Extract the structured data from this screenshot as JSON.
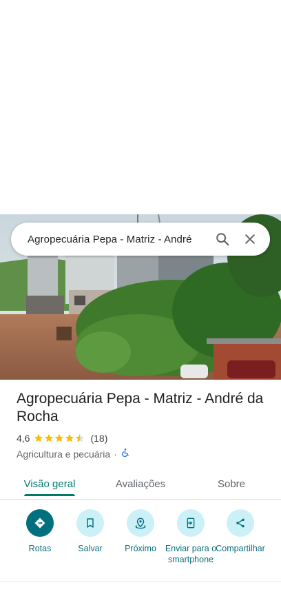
{
  "search": {
    "query": "Agropecuária Pepa - Matriz - André",
    "search_icon": "search-icon",
    "close_icon": "close-icon"
  },
  "place": {
    "name": "Agropecuária Pepa - Matriz - André da Rocha",
    "rating": "4,6",
    "stars": 4.6,
    "reviews": "(18)",
    "category": "Agricultura e pecuária",
    "separator": "·",
    "accessibility_icon": "wheelchair-icon"
  },
  "tabs": [
    {
      "label": "Visão geral"
    },
    {
      "label": "Avaliações"
    },
    {
      "label": "Sobre"
    }
  ],
  "actions": [
    {
      "label": "Rotas",
      "icon": "directions-icon"
    },
    {
      "label": "Salvar",
      "icon": "bookmark-icon"
    },
    {
      "label": "Próximo",
      "icon": "nearby-icon"
    },
    {
      "label": "Enviar para o smartphone",
      "icon": "send-to-phone-icon"
    },
    {
      "label": "Compartilhar",
      "icon": "share-icon"
    }
  ],
  "colors": {
    "accent": "#00796b",
    "star": "#fbbc04",
    "action_bg": "#cbf0f8"
  }
}
